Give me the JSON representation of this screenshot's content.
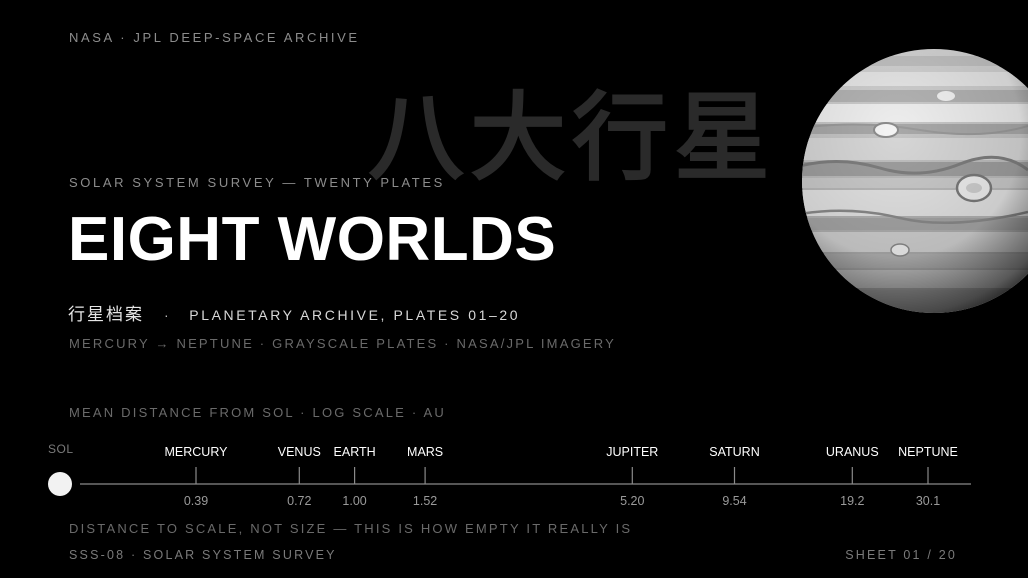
{
  "header": {
    "kicker": "NASA · JPL DEEP-SPACE ARCHIVE",
    "watermark": "八大行星"
  },
  "hero": {
    "survey_kicker": "SOLAR SYSTEM SURVEY — TWENTY PLATES",
    "title": "EIGHT WORLDS",
    "subtitle_cn": "行星档案",
    "subtitle_separator": "·",
    "subtitle_en": "PLANETARY ARCHIVE, PLATES 01–20",
    "description": "MERCURY → NEPTUNE · GRAYSCALE PLATES · NASA/JPL IMAGERY"
  },
  "scale": {
    "label": "MEAN DISTANCE FROM SOL · LOG SCALE · AU",
    "sun_label": "SOL",
    "planets": [
      {
        "name": "MERCURY",
        "au": 0.39,
        "au_label": "0.39"
      },
      {
        "name": "VENUS",
        "au": 0.72,
        "au_label": "0.72"
      },
      {
        "name": "EARTH",
        "au": 1.0,
        "au_label": "1.00"
      },
      {
        "name": "MARS",
        "au": 1.52,
        "au_label": "1.52"
      },
      {
        "name": "JUPITER",
        "au": 5.2,
        "au_label": "5.20"
      },
      {
        "name": "SATURN",
        "au": 9.54,
        "au_label": "9.54"
      },
      {
        "name": "URANUS",
        "au": 19.2,
        "au_label": "19.2"
      },
      {
        "name": "NEPTUNE",
        "au": 30.1,
        "au_label": "30.1"
      }
    ],
    "footnote": "DISTANCE TO SCALE, NOT SIZE — THIS IS HOW EMPTY IT REALLY IS"
  },
  "footer": {
    "left": "SSS-08 · SOLAR SYSTEM SURVEY",
    "right": "SHEET 01 / 20"
  },
  "planet_image": {
    "icon": "jupiter-planet-icon"
  }
}
